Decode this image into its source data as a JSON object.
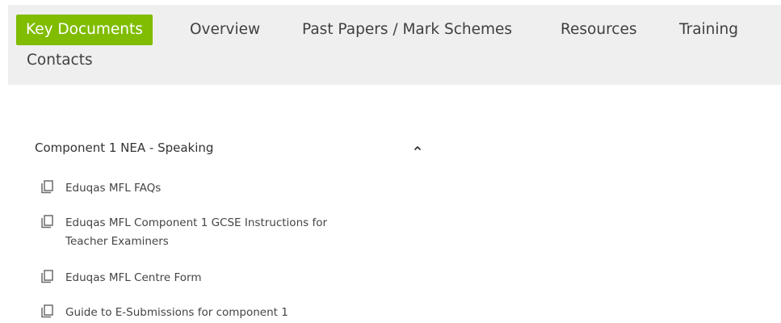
{
  "tabs": [
    {
      "label": "Key Documents",
      "active": true
    },
    {
      "label": "Overview",
      "active": false
    },
    {
      "label": "Past Papers / Mark Schemes",
      "active": false
    },
    {
      "label": "Resources",
      "active": false
    },
    {
      "label": "Training",
      "active": false
    },
    {
      "label": "Contacts",
      "active": false
    }
  ],
  "accordion": {
    "title": "Component 1 NEA - Speaking",
    "expanded": true,
    "toggle_icon": "chevron-up-icon",
    "items": [
      {
        "label": "Eduqas MFL FAQs",
        "icon": "document-copy-icon"
      },
      {
        "label": "Eduqas MFL Component 1 GCSE Instructions for Teacher Examiners",
        "icon": "document-copy-icon"
      },
      {
        "label": "Eduqas MFL Centre Form",
        "icon": "document-copy-icon"
      },
      {
        "label": "Guide to E-Submissions for component 1",
        "icon": "document-copy-icon"
      }
    ]
  },
  "colors": {
    "accent": "#80bc00",
    "tabbar_bg": "#efefef"
  }
}
